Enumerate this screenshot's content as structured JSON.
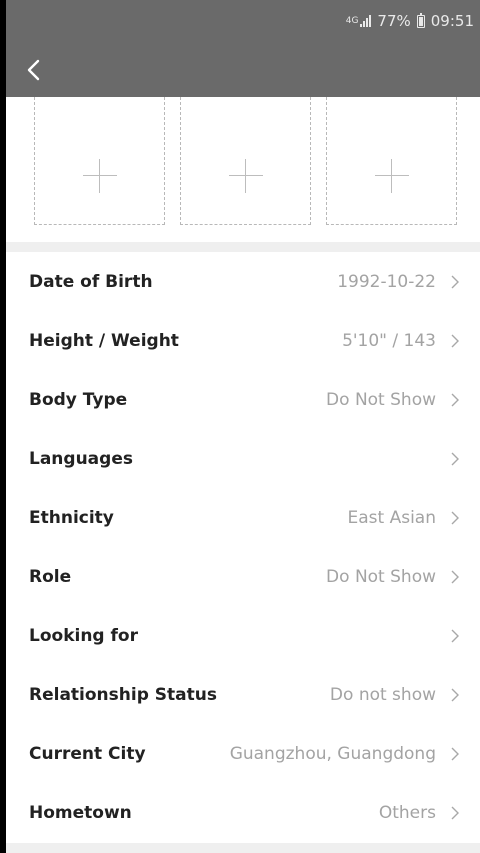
{
  "status_bar": {
    "network": "4G",
    "battery": "77%",
    "time": "09:51"
  },
  "header": {
    "back_icon": "chevron-left-icon"
  },
  "photos": {
    "slots": [
      {
        "icon": "plus-icon"
      },
      {
        "icon": "plus-icon"
      },
      {
        "icon": "plus-icon"
      }
    ]
  },
  "profile_fields": [
    {
      "label": "Date of Birth",
      "value": "1992-10-22"
    },
    {
      "label": "Height / Weight",
      "value": "5'10\" / 143"
    },
    {
      "label": "Body Type",
      "value": "Do Not Show"
    },
    {
      "label": "Languages",
      "value": ""
    },
    {
      "label": "Ethnicity",
      "value": "East Asian"
    },
    {
      "label": "Role",
      "value": "Do Not Show"
    },
    {
      "label": "Looking for",
      "value": ""
    },
    {
      "label": "Relationship Status",
      "value": "Do not show"
    },
    {
      "label": "Current City",
      "value": "Guangzhou, Guangdong"
    },
    {
      "label": "Hometown",
      "value": "Others"
    }
  ],
  "colors": {
    "header_bg": "#6a6a6a",
    "label": "#222222",
    "value": "#a3a3a3",
    "divider": "#efefef"
  }
}
